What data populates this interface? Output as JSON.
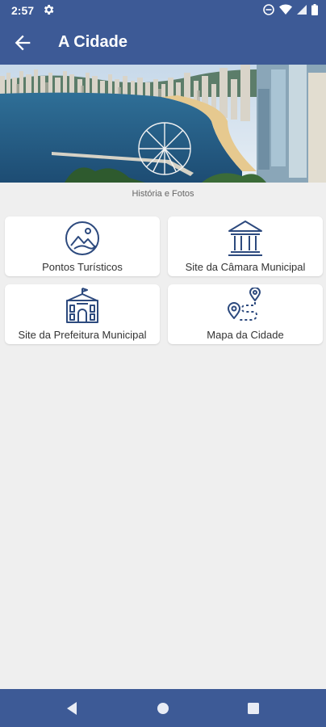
{
  "status_bar": {
    "time": "2:57",
    "icons": [
      "settings-gear-icon",
      "do-not-disturb-icon",
      "wifi-icon",
      "cell-signal-icon",
      "battery-icon"
    ]
  },
  "app_bar": {
    "title": "A Cidade",
    "back_icon": "arrow-left-icon"
  },
  "hero": {
    "caption": "História e Fotos"
  },
  "cards": [
    {
      "label": "Pontos Turísticos",
      "icon": "landscape-photo-icon"
    },
    {
      "label": "Site da Câmara Municipal",
      "icon": "courthouse-columns-icon"
    },
    {
      "label": "Site da Prefeitura Municipal",
      "icon": "city-hall-building-icon"
    },
    {
      "label": "Mapa da Cidade",
      "icon": "map-route-pins-icon"
    }
  ],
  "nav_bar": {
    "buttons": [
      "back-triangle-icon",
      "home-circle-icon",
      "recents-square-icon"
    ]
  },
  "colors": {
    "primary": "#3d5a96",
    "icon_stroke": "#2d4a7e",
    "background": "#efefef",
    "card": "#ffffff"
  }
}
